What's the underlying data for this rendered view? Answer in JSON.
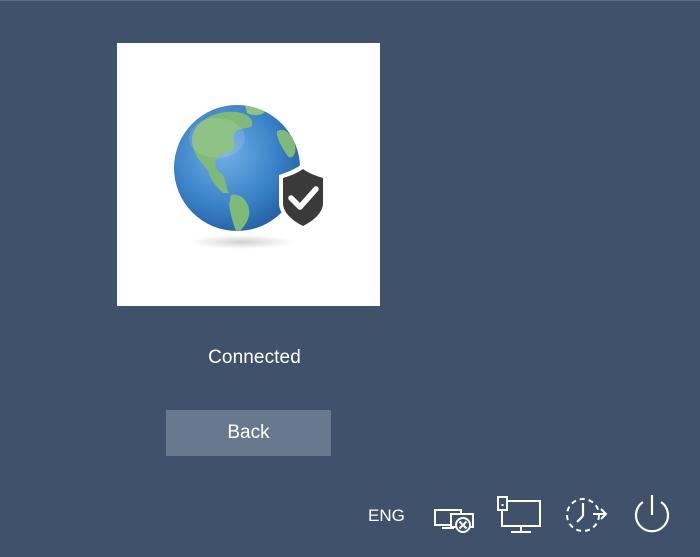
{
  "tile": {
    "image": "globe-with-shield-check-icon"
  },
  "status_text": "Connected",
  "back_button_label": "Back",
  "tray": {
    "language": "ENG",
    "icons": [
      "network-disconnected-icon",
      "remote-desktop-icon",
      "ease-of-access-icon",
      "power-icon"
    ]
  },
  "colors": {
    "background": "#40516b",
    "button": "#68788e",
    "tile": "#ffffff"
  }
}
